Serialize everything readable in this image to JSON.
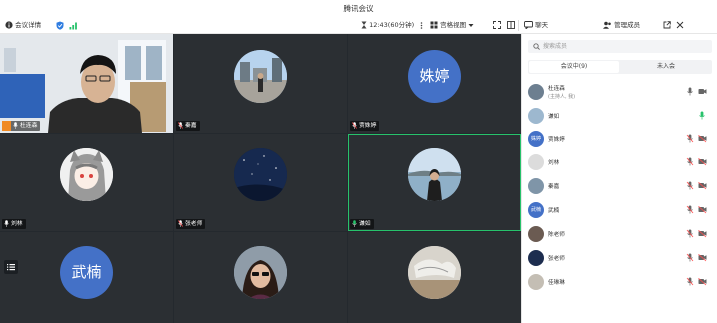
{
  "window": {
    "title": "腾讯会议"
  },
  "toolbar": {
    "info_label": "会议详情",
    "duration": "12:43(60分钟)",
    "view_label": "宫格视图",
    "chat_label": "聊天",
    "manage_label": "管理成员"
  },
  "colors": {
    "accent_green": "#27c26b",
    "avatar_blue": "#4471c7",
    "grid_bg": "#24292e"
  },
  "grid": {
    "tiles": [
      {
        "name": "杜连森",
        "kind": "camera",
        "host": true
      },
      {
        "name": "秦嘉",
        "kind": "photo-street"
      },
      {
        "name": "贾姝婷",
        "kind": "initials",
        "initials": "姝婷"
      },
      {
        "name": "刘林",
        "kind": "photo-anime"
      },
      {
        "name": "张老师",
        "kind": "photo-night"
      },
      {
        "name": "谦如",
        "kind": "photo-lake",
        "speaking": true
      },
      {
        "name": "武楠",
        "kind": "initials",
        "initials": "武楠"
      },
      {
        "name": "陈老师",
        "kind": "photo-woman"
      },
      {
        "name": "",
        "kind": "photo-art"
      }
    ]
  },
  "members": {
    "search_placeholder": "搜索成员",
    "tab_in": "会议中(9)",
    "tab_out": "未入会",
    "list": [
      {
        "name": "杜连森",
        "role": "(主持人, 我)",
        "mic": "on",
        "cam": "on",
        "avatar": "photo"
      },
      {
        "name": "谦如",
        "role": "",
        "mic": "speaking",
        "cam": "none",
        "avatar": "photo"
      },
      {
        "name": "贾姝婷",
        "role": "",
        "mic": "off",
        "cam": "off",
        "avatar": "initials",
        "initials": "姝婷"
      },
      {
        "name": "刘林",
        "role": "",
        "mic": "off",
        "cam": "off",
        "avatar": "photo"
      },
      {
        "name": "秦嘉",
        "role": "",
        "mic": "off",
        "cam": "off",
        "avatar": "photo"
      },
      {
        "name": "武楠",
        "role": "",
        "mic": "off",
        "cam": "off",
        "avatar": "initials",
        "initials": "武楠"
      },
      {
        "name": "陈老师",
        "role": "",
        "mic": "off",
        "cam": "off",
        "avatar": "photo"
      },
      {
        "name": "张老师",
        "role": "",
        "mic": "off",
        "cam": "off",
        "avatar": "photo"
      },
      {
        "name": "佳琳琳",
        "role": "",
        "mic": "off",
        "cam": "off",
        "avatar": "photo"
      }
    ]
  }
}
